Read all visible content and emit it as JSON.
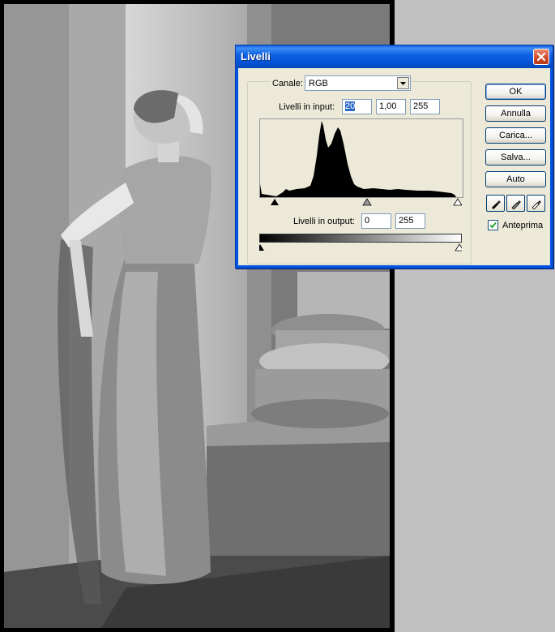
{
  "dialog": {
    "title": "Livelli",
    "channel_label": "Canale:",
    "channel_value": "RGB",
    "input_levels_label": "Livelli in input:",
    "input_black": "20",
    "input_gamma": "1,00",
    "input_white": "255",
    "output_levels_label": "Livelli in output:",
    "output_black": "0",
    "output_white": "255",
    "buttons": {
      "ok": "OK",
      "cancel": "Annulla",
      "load": "Carica...",
      "save": "Salva...",
      "auto": "Auto"
    },
    "preview_label": "Anteprima",
    "preview_checked": true
  },
  "icons": {
    "close": "close-icon",
    "dropdown": "chevron-down-icon",
    "eyedroppers": [
      "black-eyedropper-icon",
      "gray-eyedropper-icon",
      "white-eyedropper-icon"
    ]
  }
}
